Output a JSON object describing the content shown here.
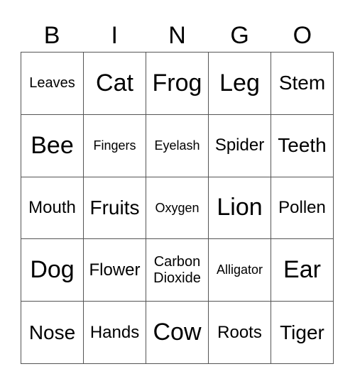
{
  "header": [
    "B",
    "I",
    "N",
    "G",
    "O"
  ],
  "cells": [
    [
      "Leaves",
      "Cat",
      "Frog",
      "Leg",
      "Stem"
    ],
    [
      "Bee",
      "Fingers",
      "Eyelash",
      "Spider",
      "Teeth"
    ],
    [
      "Mouth",
      "Fruits",
      "Oxygen",
      "Lion",
      "Pollen"
    ],
    [
      "Dog",
      "Flower",
      "Carbon Dioxide",
      "Alligator",
      "Ear"
    ],
    [
      "Nose",
      "Hands",
      "Cow",
      "Roots",
      "Tiger"
    ]
  ]
}
